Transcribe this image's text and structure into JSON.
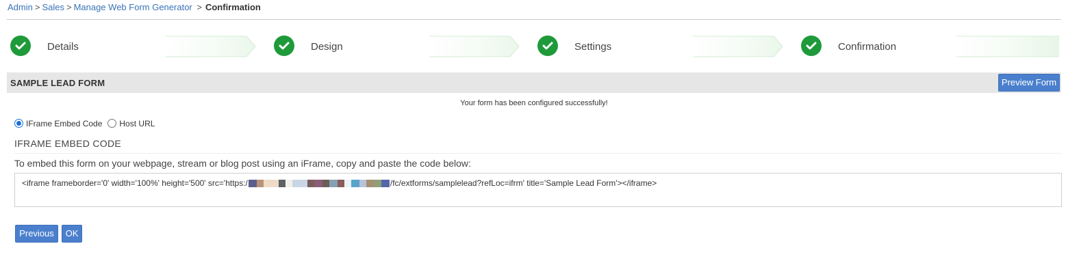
{
  "breadcrumb": {
    "items": [
      "Admin",
      "Sales",
      "Manage Web Form Generator"
    ],
    "separator": ">",
    "current": "Confirmation"
  },
  "steps": [
    {
      "label": "Details",
      "status": "complete"
    },
    {
      "label": "Design",
      "status": "complete"
    },
    {
      "label": "Settings",
      "status": "complete"
    },
    {
      "label": "Confirmation",
      "status": "complete"
    }
  ],
  "panel": {
    "title": "SAMPLE LEAD FORM",
    "preview_button": "Preview Form",
    "success_message": "Your form has been configured successfully!"
  },
  "embed_options": {
    "iframe_label": "IFrame Embed Code",
    "host_label": "Host URL",
    "selected": "iframe"
  },
  "embed": {
    "section_title": "IFRAME EMBED CODE",
    "instructions": "To embed this form on your webpage, stream or blog post using an iFrame, copy and paste the code below:",
    "code_prefix": "<iframe frameborder='0' width='100%' height='500' src='https:/",
    "code_suffix": "/fc/extforms/samplelead?refLoc=ifrm' title='Sample Lead Form'></iframe>"
  },
  "actions": {
    "previous": "Previous",
    "ok": "OK"
  },
  "colors": {
    "accent": "#4a7fcd",
    "link": "#3a73b8",
    "step_complete": "#1f9a3a",
    "header_bg": "#e6e6e6"
  },
  "icons": {
    "step_status": "checkmark-icon"
  }
}
